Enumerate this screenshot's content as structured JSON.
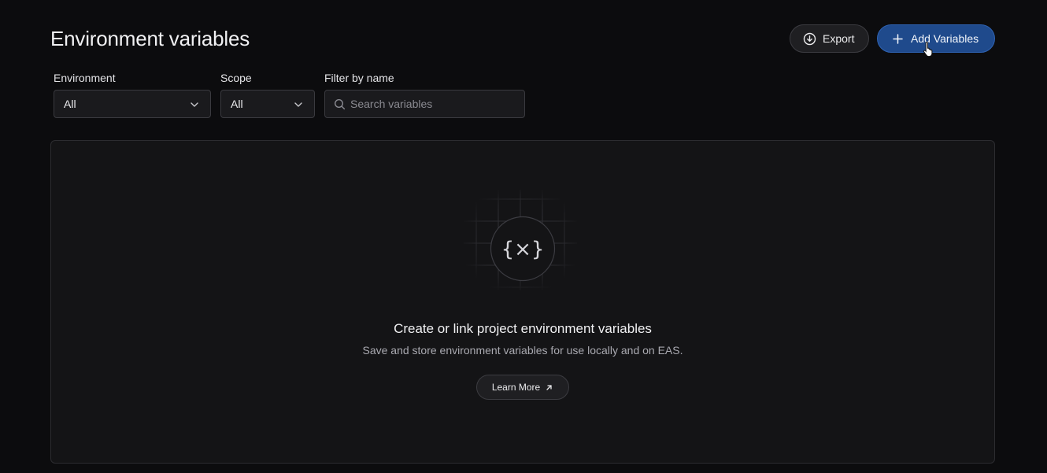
{
  "header": {
    "title": "Environment variables",
    "export_label": "Export",
    "add_label": "Add Variables"
  },
  "filters": {
    "environment": {
      "label": "Environment",
      "value": "All"
    },
    "scope": {
      "label": "Scope",
      "value": "All"
    },
    "name_filter": {
      "label": "Filter by name",
      "placeholder": "Search variables",
      "value": ""
    }
  },
  "empty_state": {
    "icon_text": "{×}",
    "title": "Create or link project environment variables",
    "description": "Save and store environment variables for use locally and on EAS.",
    "learn_more_label": "Learn More"
  },
  "icons": {
    "export": "download-circle-icon",
    "add": "plus-icon",
    "chevron": "chevron-down-icon",
    "search": "search-icon",
    "external": "arrow-up-right-icon",
    "variable": "variable-braces-icon"
  },
  "colors": {
    "background": "#0c0c0e",
    "panel": "#141416",
    "accent": "#1f4a8c",
    "border": "#3a3a3f"
  }
}
